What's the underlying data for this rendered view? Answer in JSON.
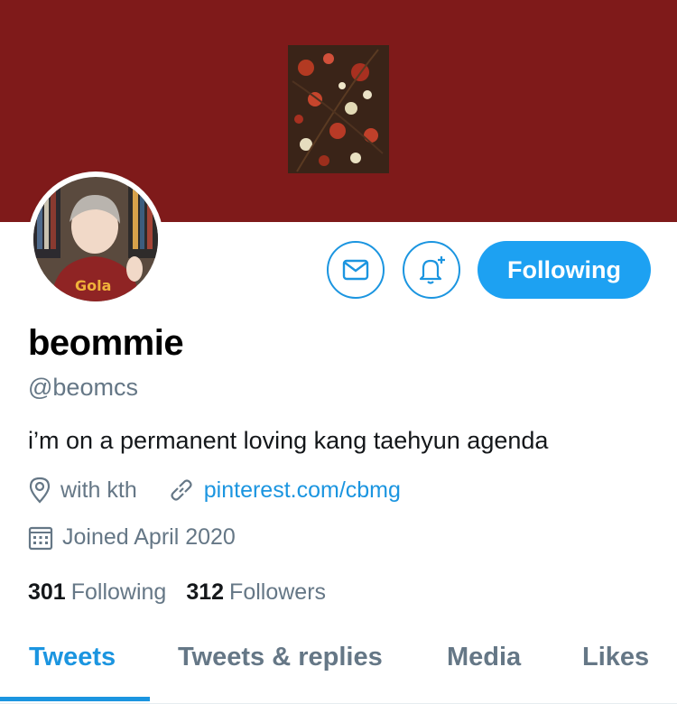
{
  "colors": {
    "banner": "#7f1a1a",
    "accent": "#1da1f2",
    "link": "#1b95e0",
    "secondary_text": "#657786"
  },
  "profile": {
    "display_name": "beommie",
    "handle": "@beomcs",
    "bio": "i’m on a permanent loving kang taehyun agenda",
    "location": "with kth",
    "website": "pinterest.com/cbmg",
    "joined": "Joined April 2020"
  },
  "actions": {
    "message_icon": "envelope-icon",
    "notify_icon": "bell-plus-icon",
    "follow_label": "Following"
  },
  "stats": {
    "following_count": "301",
    "following_label": "Following",
    "followers_count": "312",
    "followers_label": "Followers"
  },
  "tabs": [
    {
      "label": "Tweets",
      "active": true
    },
    {
      "label": "Tweets & replies",
      "active": false
    },
    {
      "label": "Media",
      "active": false
    },
    {
      "label": "Likes",
      "active": false
    }
  ],
  "avatar": {
    "shirt_text": "Gola"
  }
}
